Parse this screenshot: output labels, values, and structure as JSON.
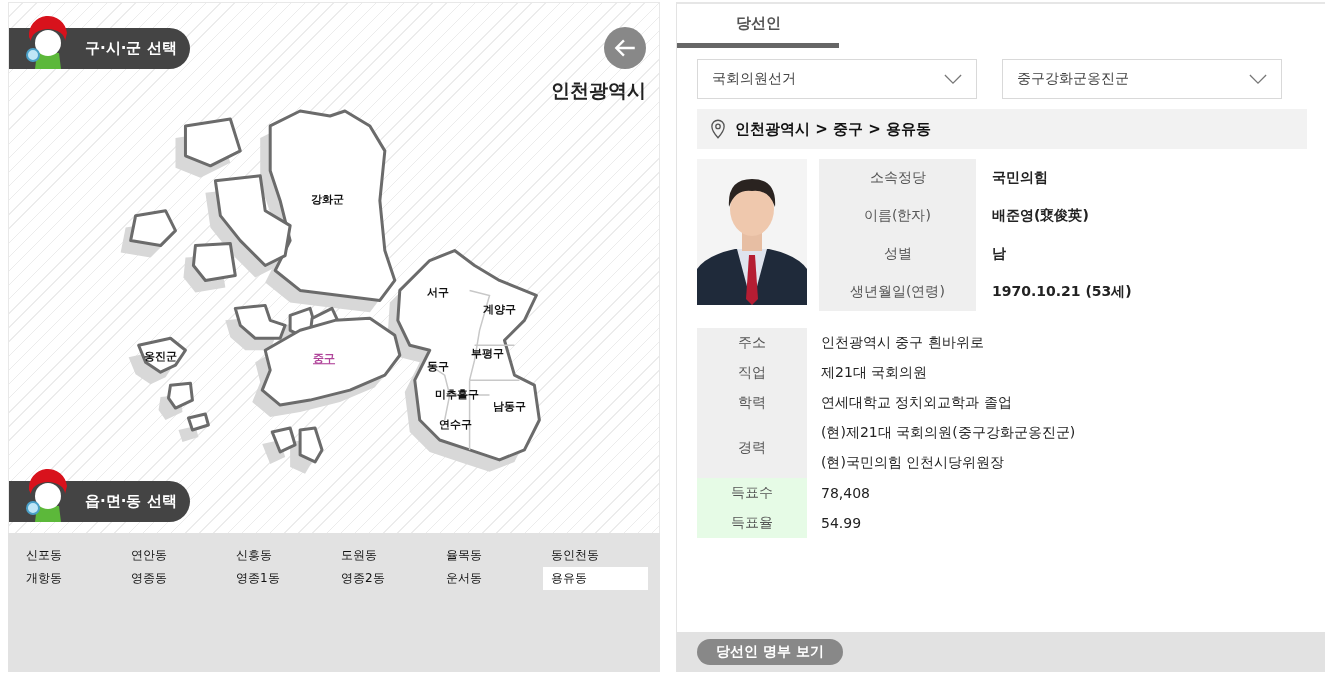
{
  "district_panel": {
    "badge": "구·시·군 선택",
    "city": "인천광역시",
    "districts": [
      {
        "label": "강화군",
        "selected": false
      },
      {
        "label": "서구",
        "selected": false
      },
      {
        "label": "계양구",
        "selected": false
      },
      {
        "label": "옹진군",
        "selected": false
      },
      {
        "label": "중구",
        "selected": true
      },
      {
        "label": "부평구",
        "selected": false
      },
      {
        "label": "동구",
        "selected": false
      },
      {
        "label": "미추홀구",
        "selected": false
      },
      {
        "label": "남동구",
        "selected": false
      },
      {
        "label": "연수구",
        "selected": false
      }
    ]
  },
  "dong_panel": {
    "badge": "읍·면·동 선택",
    "dongs": [
      {
        "label": "신포동",
        "selected": false
      },
      {
        "label": "연안동",
        "selected": false
      },
      {
        "label": "신흥동",
        "selected": false
      },
      {
        "label": "도원동",
        "selected": false
      },
      {
        "label": "율목동",
        "selected": false
      },
      {
        "label": "동인천동",
        "selected": false
      },
      {
        "label": "개항동",
        "selected": false
      },
      {
        "label": "영종동",
        "selected": false
      },
      {
        "label": "영종1동",
        "selected": false
      },
      {
        "label": "영종2동",
        "selected": false
      },
      {
        "label": "운서동",
        "selected": false
      },
      {
        "label": "용유동",
        "selected": true
      }
    ]
  },
  "results": {
    "tabs": [
      {
        "label": "당선인",
        "selected": true
      }
    ],
    "selects": [
      {
        "value": "국회의원선거"
      },
      {
        "value": "중구강화군옹진군"
      }
    ],
    "location": "인천광역시 > 중구 > 용유동",
    "profile": [
      {
        "label": "소속정당",
        "value": "국민의힘"
      },
      {
        "label": "이름(한자)",
        "value": "배준영(裵俊英)"
      },
      {
        "label": "성별",
        "value": "남"
      },
      {
        "label": "생년월일(연령)",
        "value": "1970.10.21 (53세)"
      }
    ],
    "details": [
      {
        "kind": "info",
        "label": "주소",
        "values": [
          "인천광역시 중구 흰바위로"
        ]
      },
      {
        "kind": "info",
        "label": "직업",
        "values": [
          "제21대 국회의원"
        ]
      },
      {
        "kind": "info",
        "label": "학력",
        "values": [
          "연세대학교 정치외교학과 졸업"
        ]
      },
      {
        "kind": "info",
        "label": "경력",
        "values": [
          "(현)제21대 국회의원(중구강화군옹진군)",
          "(현)국민의힘 인천시당위원장"
        ]
      },
      {
        "kind": "vote",
        "label": "득표수",
        "values": [
          "78,408"
        ]
      },
      {
        "kind": "vote",
        "label": "득표율",
        "values": [
          "54.99"
        ]
      }
    ],
    "button": "당선인 명부 보기"
  }
}
